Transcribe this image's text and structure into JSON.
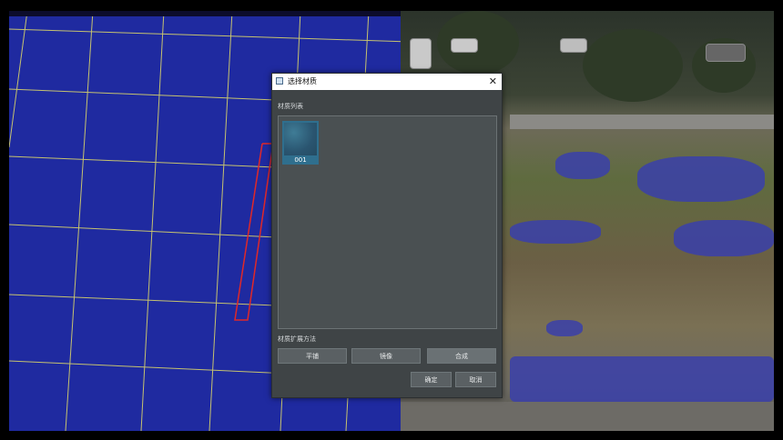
{
  "dialog": {
    "title": "选择材质",
    "close_glyph": "✕",
    "list_label": "材质列表",
    "materials": [
      {
        "name": "001"
      }
    ],
    "extend_label": "材质扩展方法",
    "extend_buttons": [
      {
        "label": "平铺"
      },
      {
        "label": "镜像"
      },
      {
        "label": "合成"
      }
    ],
    "ok_label": "确定",
    "cancel_label": "取消"
  },
  "colors": {
    "grid_water": "#1f2aa0",
    "grid_line": "#d8d36a",
    "selection_outline": "#e02828",
    "dialog_bg": "#3f4446"
  }
}
